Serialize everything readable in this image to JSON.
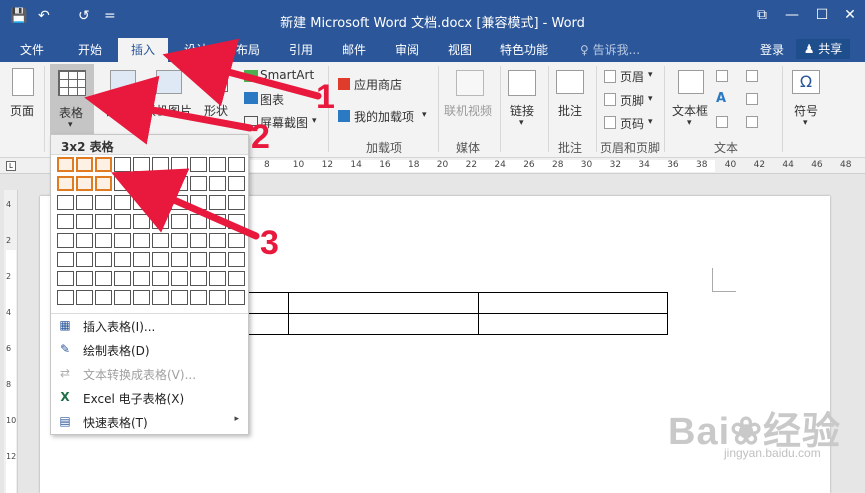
{
  "window": {
    "title": "新建 Microsoft Word 文档.docx [兼容模式] - Word",
    "controls": {
      "restore": "⧉",
      "minimize": "—",
      "maximize": "☐",
      "close": "✕"
    },
    "quick_access": {
      "save": "💾",
      "undo": "↶",
      "redo": "↺",
      "customize": "="
    }
  },
  "tabs": [
    "文件",
    "开始",
    "插入",
    "设计",
    "布局",
    "引用",
    "邮件",
    "审阅",
    "视图",
    "特色功能"
  ],
  "active_tab": "插入",
  "tell_me": "♀ 告诉我...",
  "login": "登录",
  "share": "♟ 共享",
  "ribbon": {
    "pages": {
      "label": "页面"
    },
    "table": {
      "label": "表格",
      "caret": "▾"
    },
    "pictures": {
      "label": "图片"
    },
    "online_pictures": {
      "label": "联机图片"
    },
    "shapes": {
      "label": "形状",
      "caret": "▾"
    },
    "smartart": {
      "label": "SmartArt"
    },
    "chart": {
      "label": "图表"
    },
    "screenshot": {
      "label": "屏幕截图",
      "caret": "▾"
    },
    "store": {
      "label": "应用商店"
    },
    "my_addins": {
      "label": "我的加载项",
      "caret": "▾"
    },
    "online_video": {
      "label": "联机视频"
    },
    "link": {
      "label": "链接",
      "caret": "▾"
    },
    "comment": {
      "label": "批注"
    },
    "header": {
      "label": "页眉",
      "caret": "▾"
    },
    "footer": {
      "label": "页脚",
      "caret": "▾"
    },
    "page_number": {
      "label": "页码",
      "caret": "▾"
    },
    "textbox": {
      "label": "文本框",
      "caret": "▾"
    },
    "symbol": {
      "label": "符号",
      "caret": "▾"
    },
    "groups": {
      "addins": "加载项",
      "media": "媒体",
      "comments": "批注",
      "header_footer": "页眉和页脚",
      "text": "文本"
    }
  },
  "ruler": {
    "corner": "L",
    "numbers": [
      "8",
      "10",
      "12",
      "14",
      "16",
      "18",
      "20",
      "22",
      "24",
      "26",
      "28",
      "30",
      "32",
      "34",
      "36",
      "38",
      "40",
      "42",
      "44",
      "46",
      "48"
    ],
    "vertical_numbers": [
      "4",
      "2",
      "2",
      "4",
      "6",
      "8",
      "10",
      "12"
    ]
  },
  "dropdown": {
    "header": "3x2 表格",
    "grid": {
      "cols": 10,
      "rows": 8,
      "selected_cols": 3,
      "selected_rows": 2
    },
    "items": [
      {
        "label": "插入表格(I)...",
        "icon": "table-icon",
        "disabled": false
      },
      {
        "label": "绘制表格(D)",
        "icon": "pencil-table-icon",
        "disabled": false
      },
      {
        "label": "文本转换成表格(V)...",
        "icon": "text-to-table-icon",
        "disabled": true
      },
      {
        "label": "Excel 电子表格(X)",
        "icon": "excel-icon",
        "disabled": false
      },
      {
        "label": "快速表格(T)",
        "icon": "quick-table-icon",
        "disabled": false
      }
    ],
    "submenu_arrow": "▸"
  },
  "document": {
    "table": {
      "rows": 2,
      "cols": 3
    }
  },
  "annotations": {
    "callout_1": "1",
    "callout_2": "2",
    "callout_3": "3",
    "arrow_color": "#e8193c"
  },
  "watermark": {
    "brand": "Bai❀经验",
    "url": "jingyan.baidu.com"
  },
  "colors": {
    "title_bar": "#2b579a",
    "ribbon": "#f3f3f3",
    "grid_highlight": "#e07b22"
  }
}
